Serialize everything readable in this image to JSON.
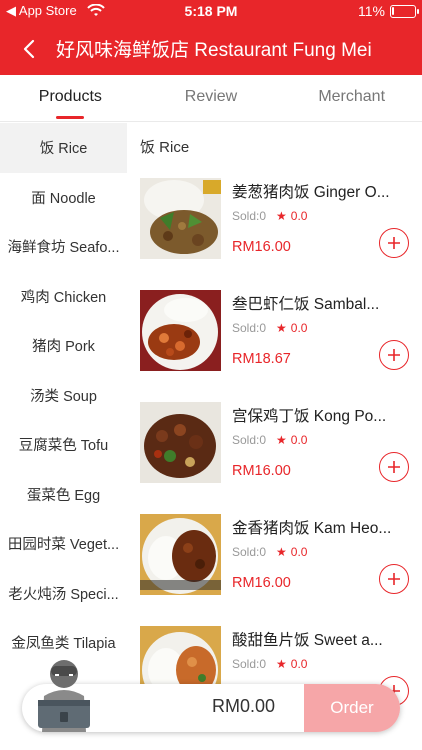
{
  "status_bar": {
    "back_label": "◀ App Store",
    "time": "5:18 PM",
    "battery": "11%",
    "battery_level": 0.11
  },
  "header": {
    "title": "好风味海鲜饭店 Restaurant Fung Mei"
  },
  "tabs": [
    {
      "label": "Products",
      "active": true
    },
    {
      "label": "Review",
      "active": false
    },
    {
      "label": "Merchant",
      "active": false
    }
  ],
  "categories": [
    {
      "label": "饭 Rice",
      "active": true
    },
    {
      "label": "面 Noodle"
    },
    {
      "label": "海鲜食坊 Seafo..."
    },
    {
      "label": "鸡肉 Chicken"
    },
    {
      "label": "猪肉 Pork"
    },
    {
      "label": "汤类 Soup"
    },
    {
      "label": "豆腐菜色 Tofu"
    },
    {
      "label": "蛋菜色 Egg"
    },
    {
      "label": "田园时菜 Veget..."
    },
    {
      "label": "老火炖汤 Speci..."
    },
    {
      "label": "金凤鱼类 Tilapia"
    }
  ],
  "section_title": "饭 Rice",
  "items": [
    {
      "name": "姜葱猪肉饭 Ginger O...",
      "sold": "Sold:0",
      "rating": "0.0",
      "price": "RM16.00"
    },
    {
      "name": "叁巴虾仁饭 Sambal...",
      "sold": "Sold:0",
      "rating": "0.0",
      "price": "RM18.67"
    },
    {
      "name": "宫保鸡丁饭 Kong Po...",
      "sold": "Sold:0",
      "rating": "0.0",
      "price": "RM16.00"
    },
    {
      "name": "金香猪肉饭 Kam Heo...",
      "sold": "Sold:0",
      "rating": "0.0",
      "price": "RM16.00"
    },
    {
      "name": "酸甜鱼片饭 Sweet a...",
      "sold": "Sold:0",
      "rating": "0.0",
      "price": ""
    }
  ],
  "cart": {
    "total": "RM0.00",
    "order_label": "Order"
  },
  "colors": {
    "brand": "#e8262a",
    "order_disabled": "#f6a6a8"
  }
}
